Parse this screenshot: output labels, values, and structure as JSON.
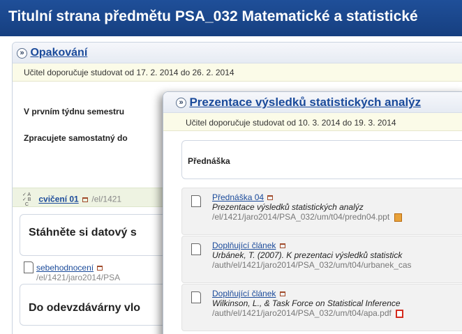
{
  "page_title": "Titulní strana předmětu PSA_032 Matematické a statistické",
  "back_section": {
    "title": "Opakování",
    "study": "Učitel doporučuje studovat od 17. 2. 2014 do 26. 2. 2014",
    "para1": "V prvním týdnu semestru",
    "para2": "Zpracujete samostatný do",
    "cviceni": {
      "link": "cvičení 01",
      "path": "/el/1421"
    },
    "box1_heading": "Stáhněte si datový s",
    "sebe": {
      "link": "sebehodnocení",
      "path": "/el/1421/jaro2014/PSA"
    },
    "box2_heading": "Do odevzdávárny vlo"
  },
  "front_section": {
    "title": "Prezentace výsledků statistických analýz",
    "study": "Učitel doporučuje studovat od 10. 3. 2014 do 19. 3. 2014",
    "box_heading": "Přednáška",
    "items": [
      {
        "link": "Přednáška 04",
        "desc": "Prezentace výsledků statistických analýz",
        "path": "/el/1421/jaro2014/PSA_032/um/t04/predn04.ppt",
        "file_icon": "ppt-icon"
      },
      {
        "link": "Doplňující článek",
        "desc": "Urbánek, T. (2007). K prezentaci výsledků statistick",
        "path": "/auth/el/1421/jaro2014/PSA_032/um/t04/urbanek_cas",
        "file_icon": ""
      },
      {
        "link": "Doplňující článek",
        "desc": "Wilkinson, L., & Task Force on Statistical Inference",
        "path": "/auth/el/1421/jaro2014/PSA_032/um/t04/apa.pdf",
        "file_icon": "pdf-icon"
      }
    ]
  },
  "icons": {
    "section_toggle": "double-chevron-right-icon",
    "document": "document-icon",
    "quiz": "abc-checklist-icon",
    "mini": "window-icon"
  }
}
